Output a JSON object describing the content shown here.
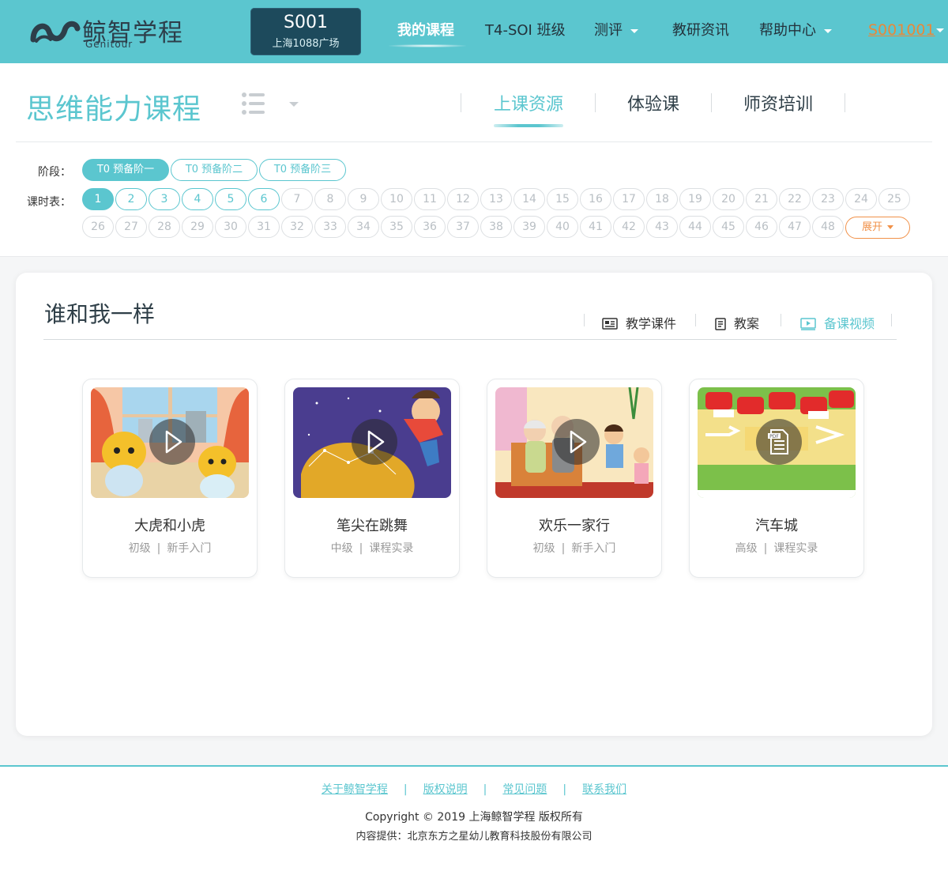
{
  "header": {
    "logo_cn": "鲸智学程",
    "logo_en": "Genitour",
    "school": {
      "code": "S001",
      "name": "上海1088广场"
    },
    "nav": [
      {
        "label": "我的课程",
        "active": true
      },
      {
        "label": "T4-SOI 班级"
      },
      {
        "label": "测评",
        "dropdown": true
      },
      {
        "label": "教研资讯"
      },
      {
        "label": "帮助中心",
        "dropdown": true
      }
    ],
    "user": "S001001"
  },
  "course": {
    "title": "思维能力课程",
    "tabs": [
      {
        "label": "上课资源",
        "active": true
      },
      {
        "label": "体验课"
      },
      {
        "label": "师资培训"
      }
    ]
  },
  "filters": {
    "stage_label": "阶段：",
    "stages": [
      "T0 预备阶一",
      "T0 预备阶二",
      "T0 预备阶三"
    ],
    "schedule_label": "课时表：",
    "lessons_row1": [
      "1",
      "2",
      "3",
      "4",
      "5",
      "6",
      "7",
      "8",
      "9",
      "10",
      "11",
      "12",
      "13",
      "14",
      "15",
      "16",
      "17",
      "18",
      "19",
      "20",
      "21",
      "22",
      "23",
      "24",
      "25"
    ],
    "lessons_row2": [
      "26",
      "27",
      "28",
      "29",
      "30",
      "31",
      "32",
      "33",
      "34",
      "35",
      "36",
      "37",
      "38",
      "39",
      "40",
      "41",
      "42",
      "43",
      "44",
      "45",
      "46",
      "47",
      "48"
    ],
    "expand_label": "展开"
  },
  "lesson": {
    "title": "谁和我一样",
    "resource_types": [
      "教学课件",
      "教案",
      "备课视频"
    ],
    "cards": [
      {
        "title": "大虎和小虎",
        "level": "初级",
        "tag": "新手入门",
        "icon": "play-icon"
      },
      {
        "title": "笔尖在跳舞",
        "level": "中级",
        "tag": "课程实录",
        "icon": "play-icon"
      },
      {
        "title": "欢乐一家行",
        "level": "初级",
        "tag": "新手入门",
        "icon": "play-icon"
      },
      {
        "title": "汽车城",
        "level": "高级",
        "tag": "课程实录",
        "icon": "pdf-icon"
      }
    ]
  },
  "footer": {
    "links": [
      "关于鲸智学程",
      "版权说明",
      "常见问题",
      "联系我们"
    ],
    "copyright": "Copyright © 2019 上海鲸智学程 版权所有",
    "provider": "内容提供：北京东方之星幼儿教育科技股份有限公司"
  },
  "colors": {
    "brand": "#5bc6cf",
    "accent": "#f19149",
    "school_bg": "#1d4a5c"
  }
}
